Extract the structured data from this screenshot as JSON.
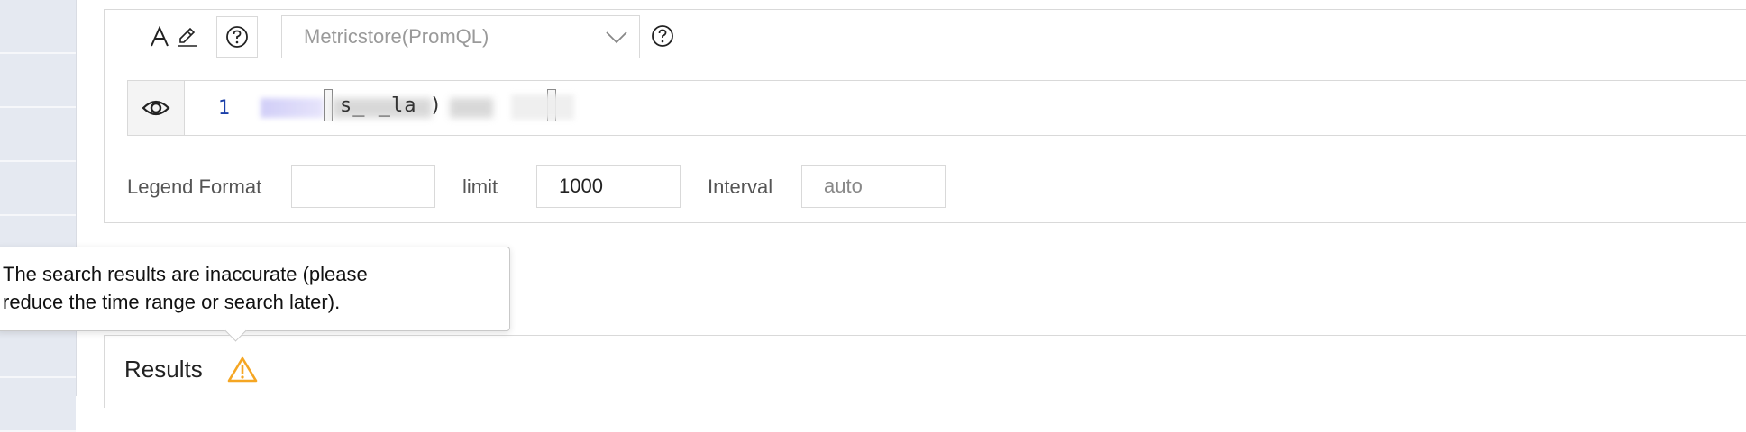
{
  "toolbar": {
    "font_icon": "text-style-icon",
    "edit_icon": "pencil-icon",
    "help_icon": "question-circle-icon",
    "datasource": {
      "selected": "Metricstore(PromQL)",
      "chevron_icon": "chevron-down-icon",
      "help_icon": "question-circle-icon"
    }
  },
  "editor": {
    "visibility_icon": "eye-icon",
    "line_number": "1",
    "query_visible_text": "s_ _la )"
  },
  "options": {
    "legend_format_label": "Legend Format",
    "legend_format_value": "",
    "limit_label": "limit",
    "limit_value": "1000",
    "interval_label": "Interval",
    "interval_placeholder": "auto"
  },
  "tooltip": {
    "line1": "The search results are inaccurate (please",
    "line2": "reduce the time range or search later)."
  },
  "results": {
    "title": "Results",
    "warning_icon": "warning-triangle-icon",
    "warning_color": "#f5a623"
  }
}
